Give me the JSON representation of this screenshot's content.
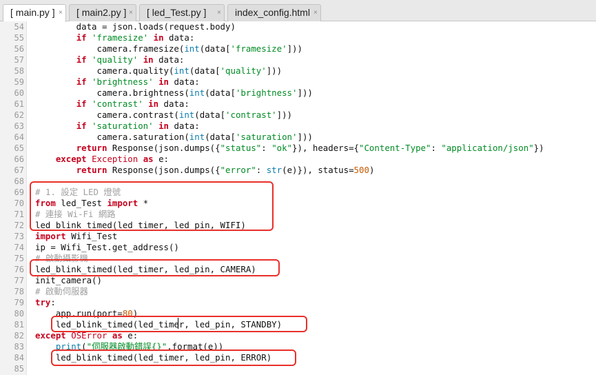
{
  "tabs": [
    {
      "label": "[ main.py ]",
      "active": true,
      "closable": true
    },
    {
      "label": "[ main2.py ]",
      "active": false,
      "closable": true
    },
    {
      "label": "[ led_Test.py ]",
      "active": false,
      "closable": true
    },
    {
      "label": "index_config.html",
      "active": false,
      "closable": true
    }
  ],
  "close_glyph": "×",
  "colors": {
    "highlight_box": "#e8302a",
    "keyword": "#c6001d",
    "string": "#008c24",
    "number": "#c75a00",
    "comment": "#a0a0a0"
  },
  "lines": [
    {
      "n": "54",
      "tokens": [
        [
          "t",
          "        data = json.loads(request.body)"
        ]
      ]
    },
    {
      "n": "55",
      "tokens": [
        [
          "t",
          "        "
        ],
        [
          "kw",
          "if"
        ],
        [
          "t",
          " "
        ],
        [
          "st",
          "'framesize'"
        ],
        [
          "t",
          " "
        ],
        [
          "kw",
          "in"
        ],
        [
          "t",
          " data:"
        ]
      ]
    },
    {
      "n": "56",
      "tokens": [
        [
          "t",
          "            camera.framesize("
        ],
        [
          "fn",
          "int"
        ],
        [
          "t",
          "(data["
        ],
        [
          "st",
          "'framesize'"
        ],
        [
          "t",
          "]))"
        ]
      ]
    },
    {
      "n": "57",
      "tokens": [
        [
          "t",
          "        "
        ],
        [
          "kw",
          "if"
        ],
        [
          "t",
          " "
        ],
        [
          "st",
          "'quality'"
        ],
        [
          "t",
          " "
        ],
        [
          "kw",
          "in"
        ],
        [
          "t",
          " data:"
        ]
      ]
    },
    {
      "n": "58",
      "tokens": [
        [
          "t",
          "            camera.quality("
        ],
        [
          "fn",
          "int"
        ],
        [
          "t",
          "(data["
        ],
        [
          "st",
          "'quality'"
        ],
        [
          "t",
          "]))"
        ]
      ]
    },
    {
      "n": "59",
      "tokens": [
        [
          "t",
          "        "
        ],
        [
          "kw",
          "if"
        ],
        [
          "t",
          " "
        ],
        [
          "st",
          "'brightness'"
        ],
        [
          "t",
          " "
        ],
        [
          "kw",
          "in"
        ],
        [
          "t",
          " data:"
        ]
      ]
    },
    {
      "n": "60",
      "tokens": [
        [
          "t",
          "            camera.brightness("
        ],
        [
          "fn",
          "int"
        ],
        [
          "t",
          "(data["
        ],
        [
          "st",
          "'brightness'"
        ],
        [
          "t",
          "]))"
        ]
      ]
    },
    {
      "n": "61",
      "tokens": [
        [
          "t",
          "        "
        ],
        [
          "kw",
          "if"
        ],
        [
          "t",
          " "
        ],
        [
          "st",
          "'contrast'"
        ],
        [
          "t",
          " "
        ],
        [
          "kw",
          "in"
        ],
        [
          "t",
          " data:"
        ]
      ]
    },
    {
      "n": "62",
      "tokens": [
        [
          "t",
          "            camera.contrast("
        ],
        [
          "fn",
          "int"
        ],
        [
          "t",
          "(data["
        ],
        [
          "st",
          "'contrast'"
        ],
        [
          "t",
          "]))"
        ]
      ]
    },
    {
      "n": "63",
      "tokens": [
        [
          "t",
          "        "
        ],
        [
          "kw",
          "if"
        ],
        [
          "t",
          " "
        ],
        [
          "st",
          "'saturation'"
        ],
        [
          "t",
          " "
        ],
        [
          "kw",
          "in"
        ],
        [
          "t",
          " data:"
        ]
      ]
    },
    {
      "n": "64",
      "tokens": [
        [
          "t",
          "            camera.saturation("
        ],
        [
          "fn",
          "int"
        ],
        [
          "t",
          "(data["
        ],
        [
          "st",
          "'saturation'"
        ],
        [
          "t",
          "]))"
        ]
      ]
    },
    {
      "n": "65",
      "tokens": [
        [
          "t",
          "        "
        ],
        [
          "kw",
          "return"
        ],
        [
          "t",
          " Response(json.dumps({"
        ],
        [
          "st",
          "\"status\""
        ],
        [
          "t",
          ": "
        ],
        [
          "st",
          "\"ok\""
        ],
        [
          "t",
          "}), headers={"
        ],
        [
          "st",
          "\"Content-Type\""
        ],
        [
          "t",
          ": "
        ],
        [
          "st",
          "\"application/json\""
        ],
        [
          "t",
          "})"
        ]
      ]
    },
    {
      "n": "66",
      "tokens": [
        [
          "t",
          "    "
        ],
        [
          "kw",
          "except"
        ],
        [
          "t",
          " "
        ],
        [
          "ex",
          "Exception"
        ],
        [
          "t",
          " "
        ],
        [
          "kw",
          "as"
        ],
        [
          "t",
          " e:"
        ]
      ]
    },
    {
      "n": "67",
      "tokens": [
        [
          "t",
          "        "
        ],
        [
          "kw",
          "return"
        ],
        [
          "t",
          " Response(json.dumps({"
        ],
        [
          "st",
          "\"error\""
        ],
        [
          "t",
          ": "
        ],
        [
          "fn",
          "str"
        ],
        [
          "t",
          "(e)}), status="
        ],
        [
          "nm",
          "500"
        ],
        [
          "t",
          ")"
        ]
      ]
    },
    {
      "n": "68",
      "tokens": []
    },
    {
      "n": "69",
      "tokens": [
        [
          "cm",
          "# 1. 設定 LED 燈號"
        ]
      ]
    },
    {
      "n": "70",
      "tokens": [
        [
          "kw",
          "from"
        ],
        [
          "t",
          " led_Test "
        ],
        [
          "kw",
          "import"
        ],
        [
          "t",
          " *"
        ]
      ]
    },
    {
      "n": "71",
      "tokens": [
        [
          "cm",
          "# 連接 Wi-Fi 網路"
        ]
      ]
    },
    {
      "n": "72",
      "tokens": [
        [
          "t",
          "led_blink_timed(led_timer, led_pin, WIFI)"
        ]
      ]
    },
    {
      "n": "73",
      "tokens": [
        [
          "kw",
          "import"
        ],
        [
          "t",
          " Wifi_Test"
        ]
      ]
    },
    {
      "n": "74",
      "tokens": [
        [
          "t",
          "ip = Wifi_Test.get_address()"
        ]
      ]
    },
    {
      "n": "75",
      "tokens": [
        [
          "cm",
          "# 啟動攝影機"
        ]
      ]
    },
    {
      "n": "76",
      "tokens": [
        [
          "t",
          "led_blink_timed(led_timer, led_pin, CAMERA)"
        ]
      ]
    },
    {
      "n": "77",
      "tokens": [
        [
          "t",
          "init_camera()"
        ]
      ]
    },
    {
      "n": "78",
      "tokens": [
        [
          "cm",
          "# 啟動伺服器"
        ]
      ]
    },
    {
      "n": "79",
      "tokens": [
        [
          "kw",
          "try"
        ],
        [
          "t",
          ":"
        ]
      ]
    },
    {
      "n": "80",
      "tokens": [
        [
          "t",
          "    app.run(port="
        ],
        [
          "nm",
          "80"
        ],
        [
          "t",
          ")"
        ]
      ]
    },
    {
      "n": "81",
      "tokens": [
        [
          "t",
          "    led_blink_timed(led_timer, led_pin, STANDBY)"
        ]
      ]
    },
    {
      "n": "82",
      "tokens": [
        [
          "kw",
          "except"
        ],
        [
          "t",
          " "
        ],
        [
          "ex",
          "OSError"
        ],
        [
          "t",
          " "
        ],
        [
          "kw",
          "as"
        ],
        [
          "t",
          " e:"
        ]
      ]
    },
    {
      "n": "83",
      "tokens": [
        [
          "t",
          "    "
        ],
        [
          "fn",
          "print"
        ],
        [
          "t",
          "("
        ],
        [
          "st",
          "\"伺服器啟動錯誤{}\""
        ],
        [
          "t",
          ".format(e))"
        ]
      ]
    },
    {
      "n": "84",
      "tokens": [
        [
          "t",
          "    led_blink_timed(led_timer, led_pin, ERROR)"
        ]
      ]
    },
    {
      "n": "85",
      "tokens": []
    }
  ]
}
